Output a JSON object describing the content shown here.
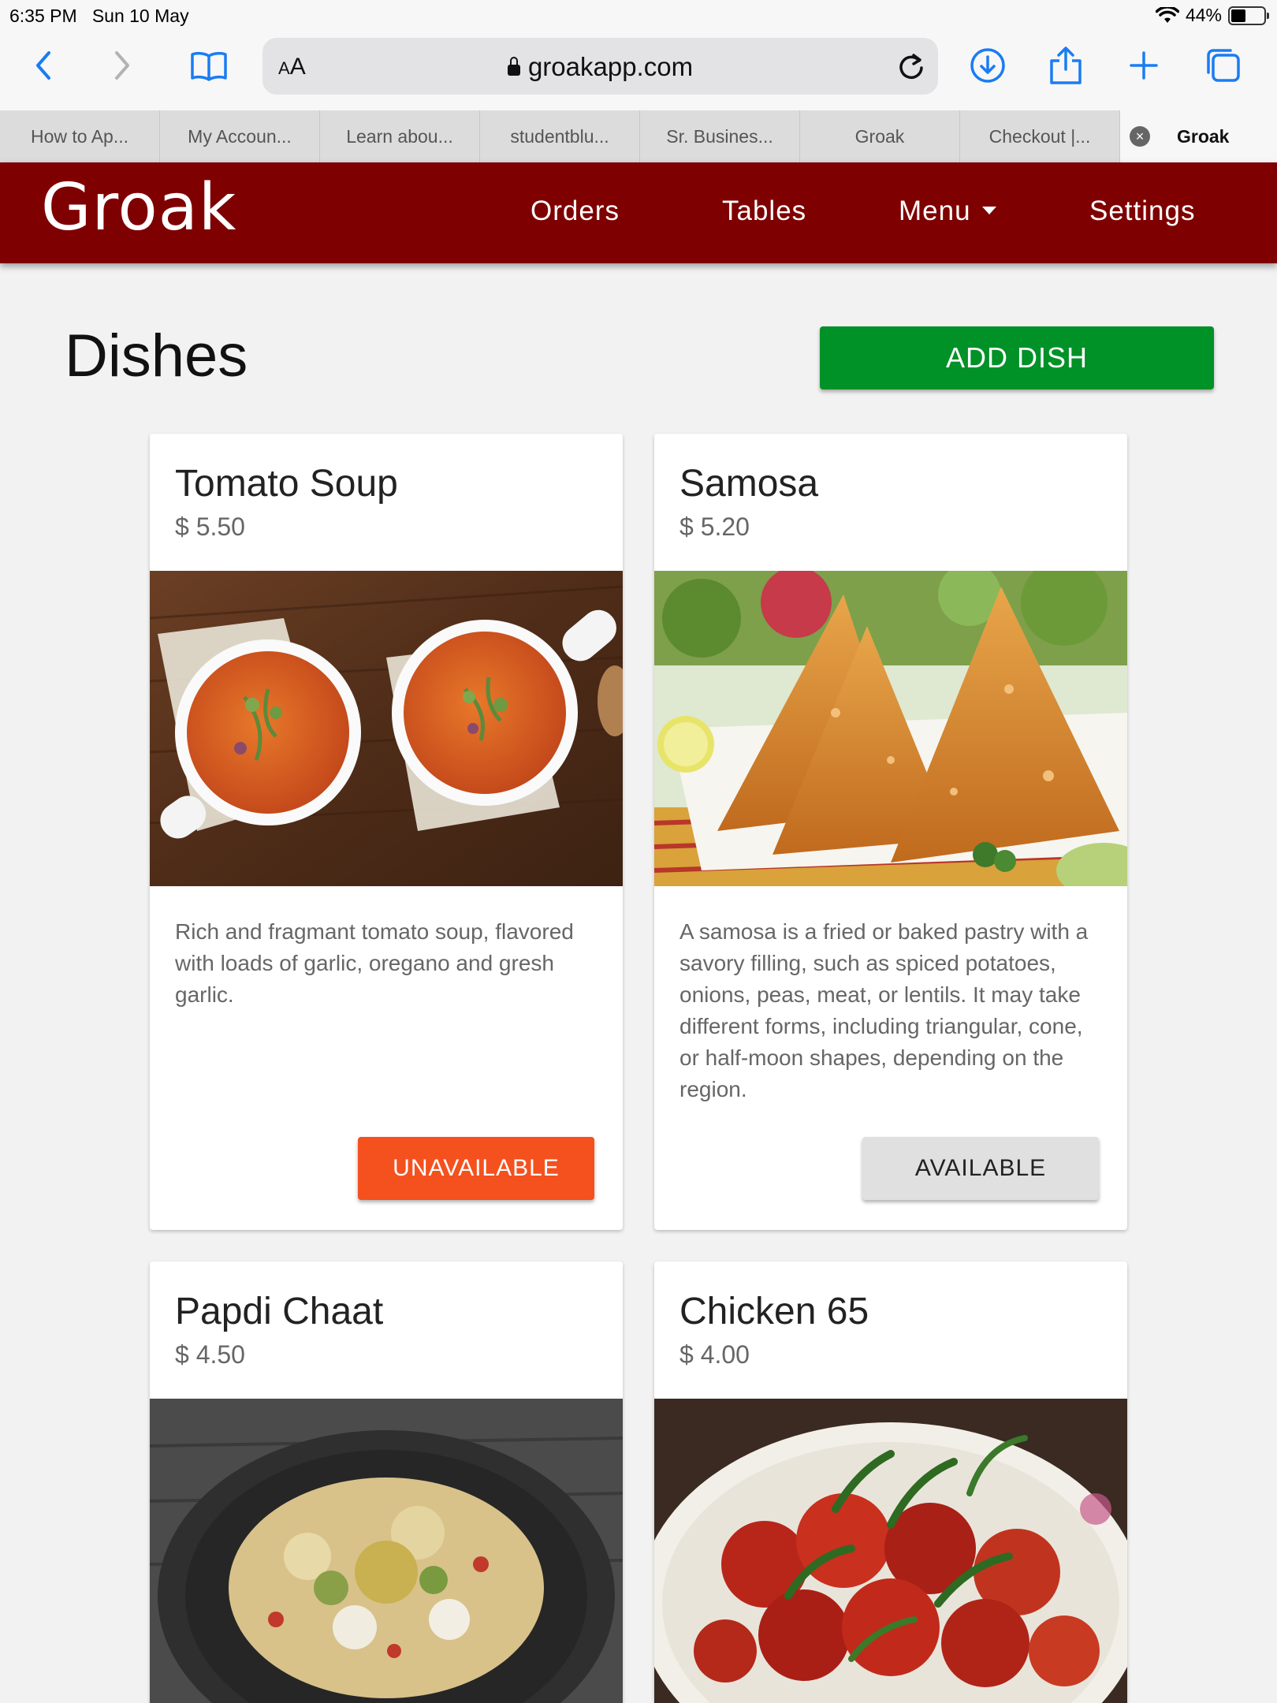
{
  "status": {
    "time": "6:35 PM",
    "date": "Sun 10 May",
    "battery": "44%",
    "battery_level": 0.44
  },
  "browser": {
    "aa_label_small": "A",
    "aa_label_large": "A",
    "url": "groakapp.com",
    "icons": [
      "back-icon",
      "forward-icon",
      "bookmarks-icon",
      "reload-icon",
      "download-icon",
      "share-icon",
      "new-tab-icon",
      "tabs-overview-icon"
    ],
    "tabs": [
      {
        "label": "How to Ap..."
      },
      {
        "label": "My Accoun..."
      },
      {
        "label": "Learn abou..."
      },
      {
        "label": "studentblu..."
      },
      {
        "label": "Sr. Busines..."
      },
      {
        "label": "Groak"
      },
      {
        "label": "Checkout |..."
      },
      {
        "label": "Groak",
        "active": true
      }
    ]
  },
  "app": {
    "logo": "Groak",
    "nav": {
      "orders": "Orders",
      "tables": "Tables",
      "menu": "Menu",
      "settings": "Settings"
    },
    "brand_color": "#7f0000"
  },
  "page": {
    "title": "Dishes",
    "add_button": "ADD DISH",
    "dishes": [
      {
        "name": "Tomato Soup",
        "price": "$ 5.50",
        "description": "Rich and fragmant tomato soup, flavored with loads of garlic, oregano and gresh garlic.",
        "status_button": "UNAVAILABLE"
      },
      {
        "name": "Samosa",
        "price": "$ 5.20",
        "description": "A samosa is a fried or baked pastry with a savory filling, such as spiced potatoes, onions, peas, meat, or lentils. It may take different forms, including triangular, cone, or half-moon shapes, depending on the region.",
        "status_button": "AVAILABLE"
      },
      {
        "name": "Papdi Chaat",
        "price": "$ 4.50"
      },
      {
        "name": "Chicken 65",
        "price": "$ 4.00"
      }
    ]
  }
}
